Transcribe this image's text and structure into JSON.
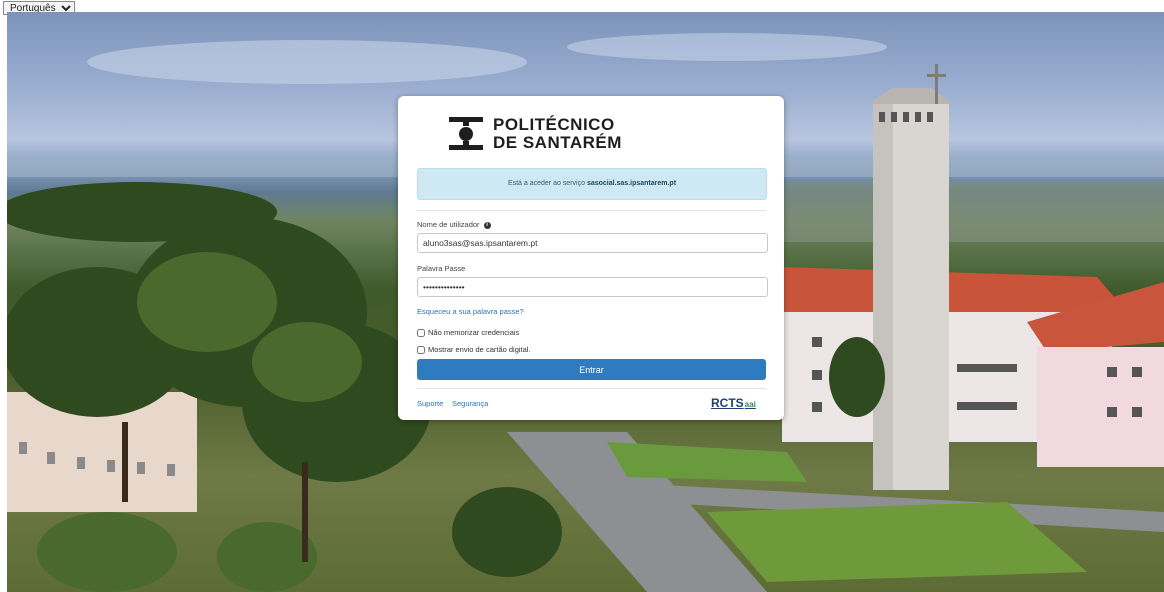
{
  "language": {
    "selected": "Português"
  },
  "logo": {
    "line1": "POLITÉCNICO",
    "line2": "DE SANTARÉM"
  },
  "notice": {
    "prefix": "Está a aceder ao serviço",
    "service": "sasocial.sas.ipsantarem.pt"
  },
  "form": {
    "username_label": "Nome de utilizador",
    "username_value": "aluno3sas@sas.ipsantarem.pt",
    "password_label": "Palavra Passe",
    "password_value": "••••••••••••••",
    "forgot_link": "Esqueceu a sua palavra passe?",
    "no_remember_label": "Não memorizar credenciais",
    "show_card_label": "Mostrar envio de cartão digital.",
    "submit_label": "Entrar"
  },
  "footer": {
    "links": [
      "Suporte",
      "Segurança"
    ],
    "brand": "RCTS",
    "brand_suffix": "aai"
  },
  "colors": {
    "primary": "#2f7bbf",
    "notice_bg": "#cfe9f4",
    "link": "#2b73b7",
    "brand": "#1d3f73"
  }
}
